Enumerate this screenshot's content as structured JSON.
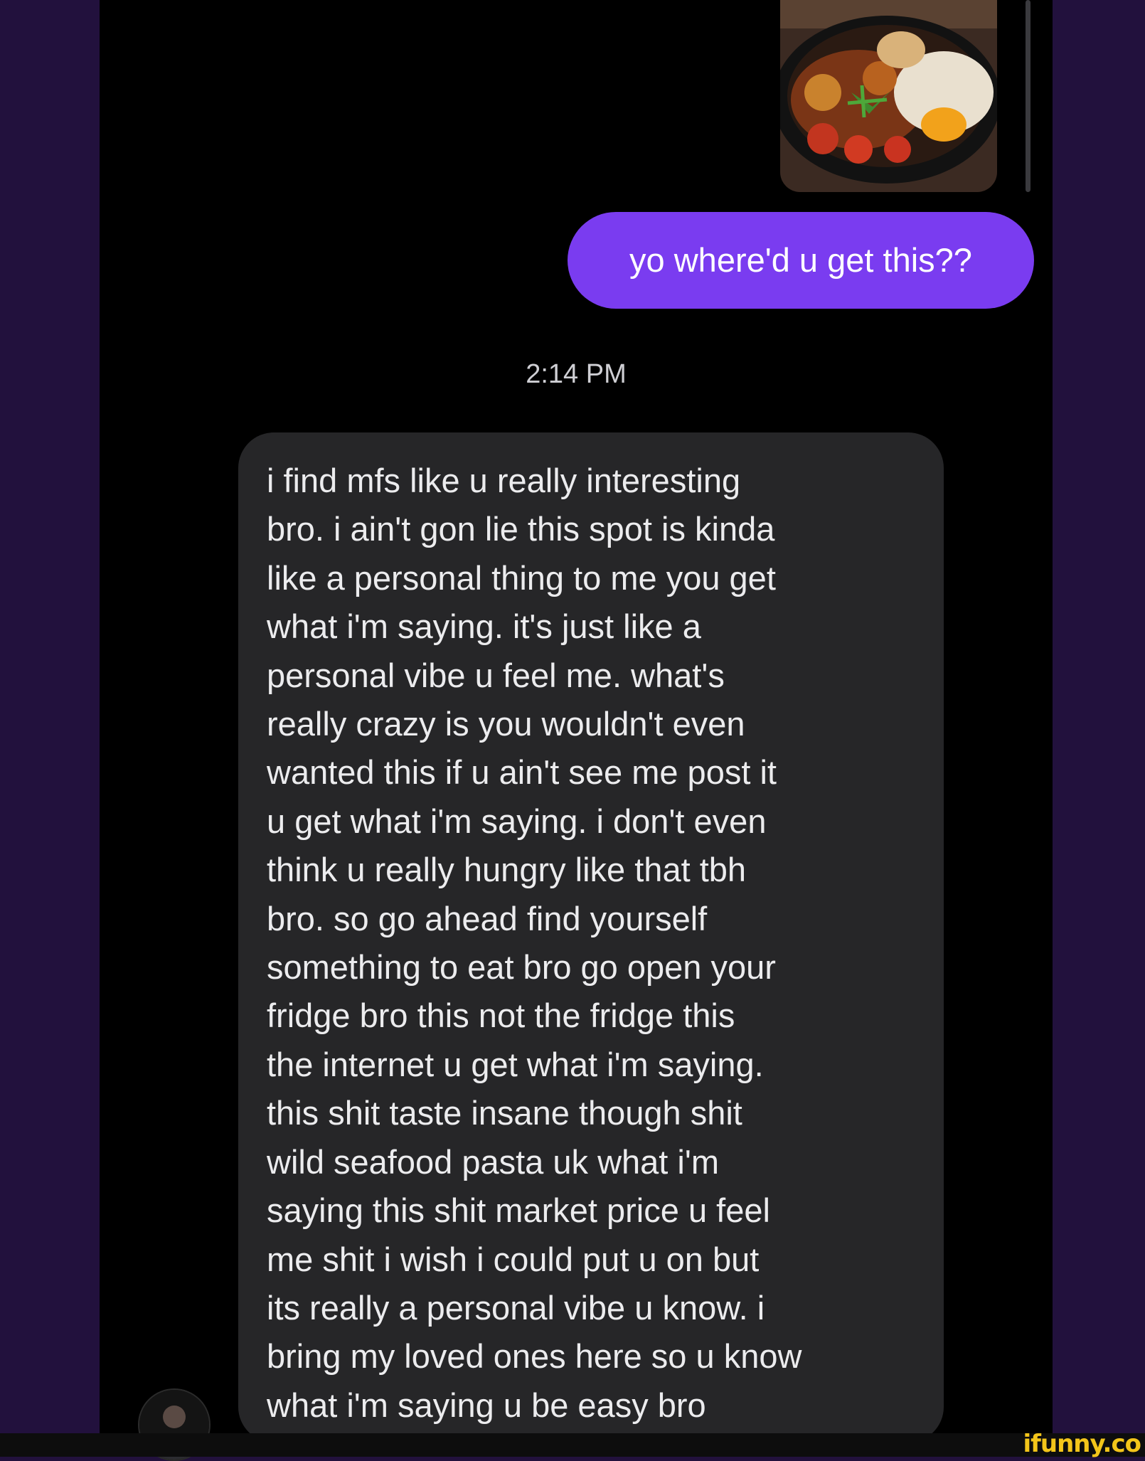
{
  "conversation": {
    "outgoing_message": "yo where'd u get this??",
    "timestamp": "2:14 PM",
    "incoming_message_lines": [
      "i find mfs like u really interesting",
      "bro. i ain't gon lie this spot is kinda",
      "like a personal thing to me you get",
      "what i'm saying. it's just like a",
      "personal vibe u feel me. what's",
      "really crazy is you wouldn't even",
      "wanted this if u ain't see me post it",
      "u get what i'm saying. i don't even",
      "think u really hungry like that tbh",
      "bro. so go ahead  find yourself",
      "something to eat bro go open your",
      "fridge bro this not the fridge this",
      "the internet u get what i'm saying.",
      "this shit taste insane though shit",
      "wild seafood pasta uk what i'm",
      "saying this shit market price u feel",
      "me shit i wish i could put u on but",
      "its really a personal vibe u know. i",
      "bring my loved ones here so u know",
      "what i'm saying u be easy bro"
    ]
  },
  "watermark": "ifunny.co",
  "colors": {
    "background_side": "#22113d",
    "chat_background": "#000000",
    "outgoing_bubble": "#7a3cf0",
    "incoming_bubble": "#262628",
    "watermark": "#f3c51a"
  },
  "icons": {
    "photo": "food-skillet-photo",
    "avatar": "user-avatar"
  }
}
